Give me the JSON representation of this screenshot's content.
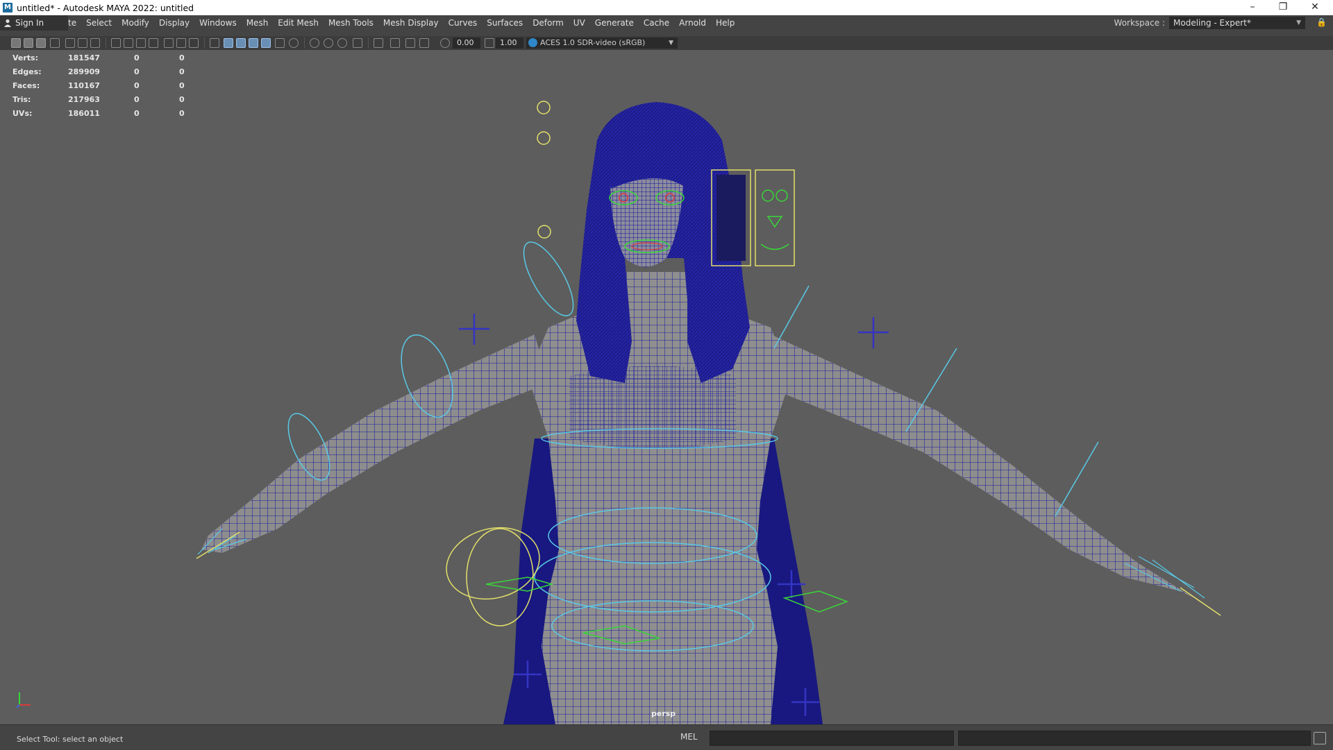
{
  "window": {
    "title": "untitled* - Autodesk MAYA 2022: untitled",
    "app_icon": "M",
    "controls": [
      "minimize-icon",
      "restore-icon",
      "close-icon"
    ],
    "minimize_glyph": "–",
    "restore_glyph": "❐",
    "close_glyph": "✕"
  },
  "menubar": {
    "signin_label": "Sign In",
    "partial_label": "te",
    "items": [
      "Select",
      "Modify",
      "Display",
      "Windows",
      "Mesh",
      "Edit Mesh",
      "Mesh Tools",
      "Mesh Display",
      "Curves",
      "Surfaces",
      "Deform",
      "UV",
      "Generate",
      "Cache",
      "Arnold",
      "Help"
    ],
    "workspace_label": "Workspace :",
    "workspace_value": "Modeling - Expert*",
    "dropdown_glyph": "▼",
    "lock_glyph": "🔒"
  },
  "panel_toolbar": {
    "exposure_value": "0.00",
    "gamma_value": "1.00",
    "color_space": "ACES 1.0 SDR-video (sRGB)"
  },
  "hud": {
    "rows": [
      {
        "label": "Verts:",
        "value": "181547",
        "sel": "0",
        "uv": "0"
      },
      {
        "label": "Edges:",
        "value": "289909",
        "sel": "0",
        "uv": "0"
      },
      {
        "label": "Faces:",
        "value": "110167",
        "sel": "0",
        "uv": "0"
      },
      {
        "label": "Tris:",
        "value": "217963",
        "sel": "0",
        "uv": "0"
      },
      {
        "label": "UVs:",
        "value": "186011",
        "sel": "0",
        "uv": "0"
      }
    ]
  },
  "viewport": {
    "camera_label": "persp",
    "background": "#5d5d5d",
    "wire_color": "#1b1b9e",
    "control_colors": {
      "cyan": "#59c9e6",
      "yellow": "#e3e06a",
      "green": "#39d639",
      "blue": "#3434c4"
    }
  },
  "statusbar": {
    "help_text": "Select Tool: select an object",
    "mel_label": "MEL"
  }
}
